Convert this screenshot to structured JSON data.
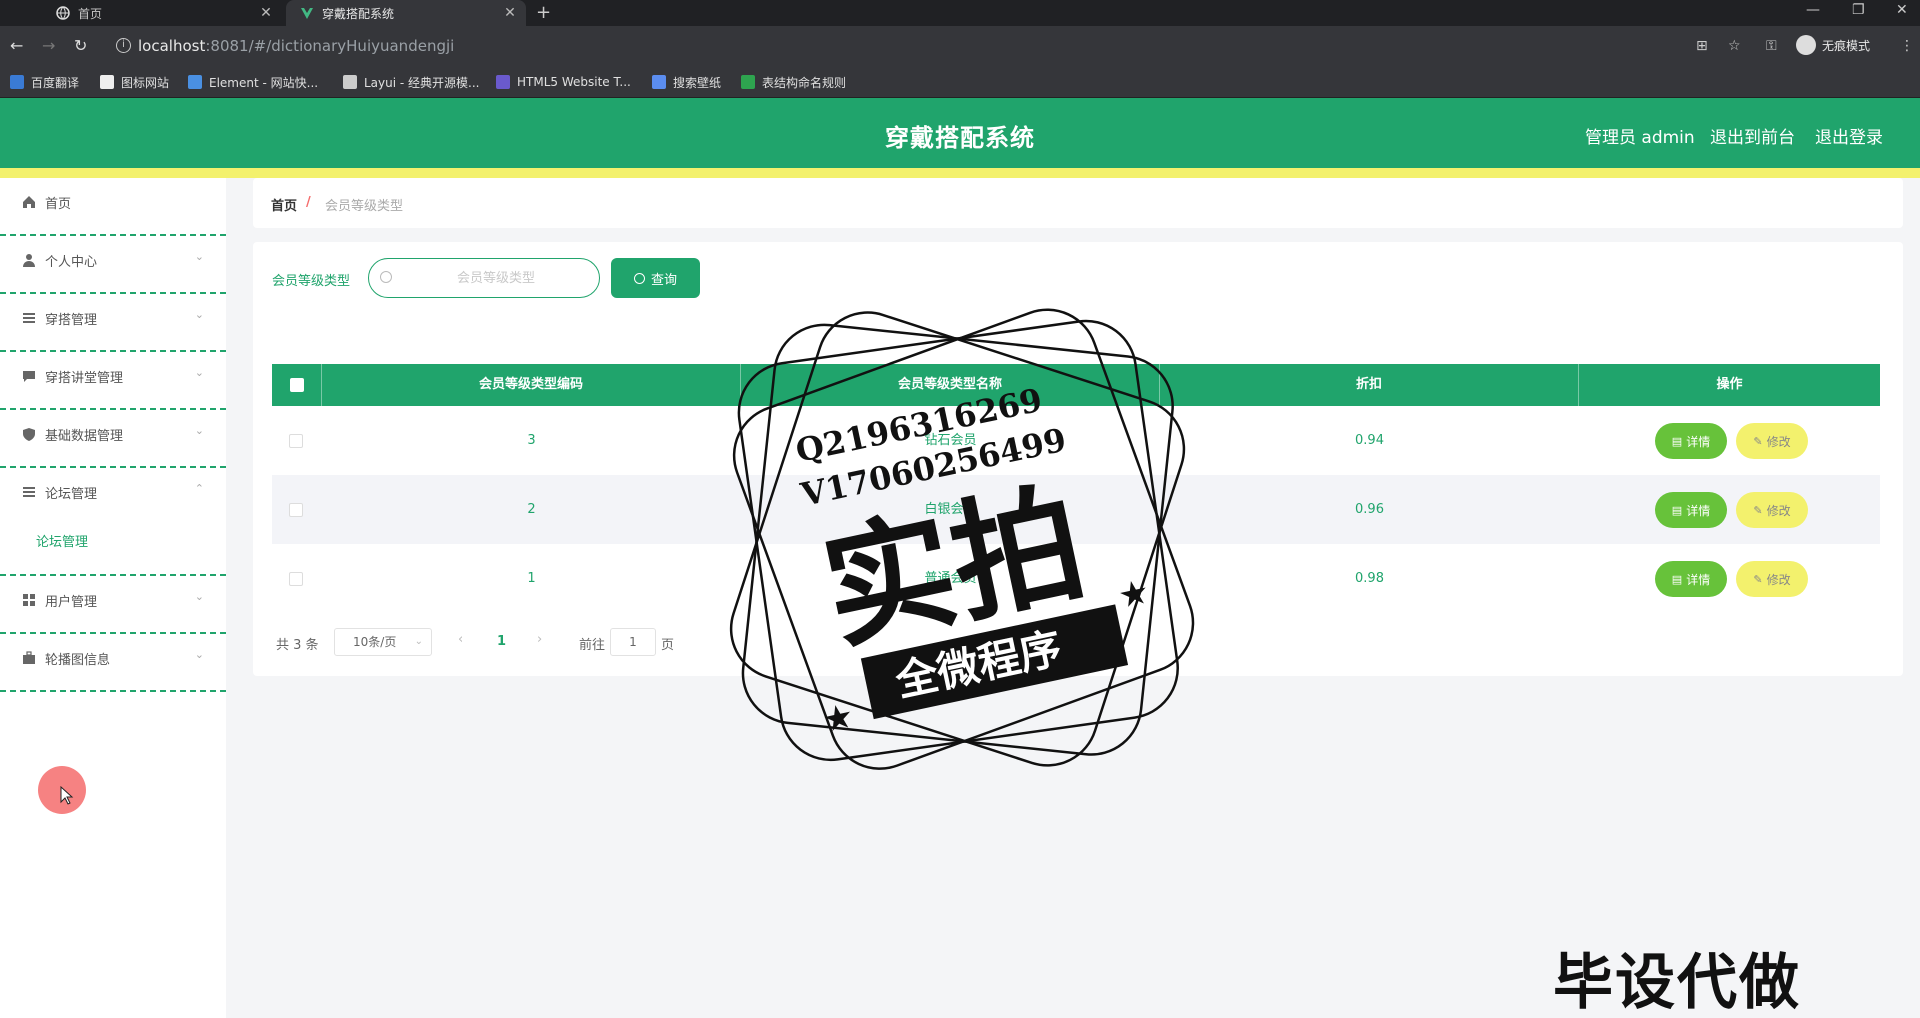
{
  "browser": {
    "tabs": [
      {
        "label": "首页",
        "active": false
      },
      {
        "label": "穿戴搭配系统",
        "active": true
      }
    ],
    "url_host": "localhost",
    "url_rest": ":8081/#/dictionaryHuiyuandengji",
    "incognito_label": "无痕模式",
    "bookmarks": [
      {
        "label": "百度翻译",
        "color": "#3a7bd5"
      },
      {
        "label": "图标网站",
        "color": "#eeeeee"
      },
      {
        "label": "Element - 网站快...",
        "color": "#4a90e2"
      },
      {
        "label": "Layui - 经典开源模...",
        "color": "#cccccc"
      },
      {
        "label": "HTML5 Website T...",
        "color": "#6a5acd"
      },
      {
        "label": "搜索壁纸",
        "color": "#5b8def"
      },
      {
        "label": "表结构命名规则",
        "color": "#2ea44f"
      }
    ]
  },
  "header": {
    "title": "穿戴搭配系统",
    "admin_label": "管理员 admin",
    "front_label": "退出到前台",
    "logout_label": "退出登录"
  },
  "sidebar": {
    "items": [
      {
        "label": "首页",
        "icon": "home-icon",
        "has_arrow": false
      },
      {
        "label": "个人中心",
        "icon": "user-icon",
        "has_arrow": true
      },
      {
        "label": "穿搭管理",
        "icon": "menu-icon",
        "has_arrow": true
      },
      {
        "label": "穿搭讲堂管理",
        "icon": "chat-icon",
        "has_arrow": true
      },
      {
        "label": "基础数据管理",
        "icon": "shield-icon",
        "has_arrow": true
      },
      {
        "label": "论坛管理",
        "icon": "menu-icon",
        "has_arrow": true,
        "expanded": true
      },
      {
        "label": "用户管理",
        "icon": "grid-icon",
        "has_arrow": true
      },
      {
        "label": "轮播图信息",
        "icon": "briefcase-icon",
        "has_arrow": true
      }
    ],
    "submenu": {
      "label": "论坛管理"
    }
  },
  "breadcrumb": {
    "home": "首页",
    "separator": "/",
    "current": "会员等级类型"
  },
  "search": {
    "label": "会员等级类型",
    "placeholder": "会员等级类型",
    "button": "查询"
  },
  "table": {
    "columns": [
      "会员等级类型编码",
      "会员等级类型名称",
      "折扣",
      "操作"
    ],
    "rows": [
      {
        "code": "3",
        "name": "钻石会员",
        "discount": "0.94"
      },
      {
        "code": "2",
        "name": "白银会员",
        "discount": "0.96"
      },
      {
        "code": "1",
        "name": "普通会员",
        "discount": "0.98"
      }
    ],
    "detail_label": "详情",
    "edit_label": "修改"
  },
  "pagination": {
    "total": "共 3 条",
    "page_size": "10条/页",
    "current": "1",
    "goto_label": "前往",
    "goto_value": "1",
    "page_suffix": "页"
  },
  "watermark": {
    "line1": "Q2196316269",
    "line2": "V17060256499",
    "big": "实拍",
    "banner": "全微程序",
    "corner": "毕设代做"
  },
  "colors": {
    "primary": "#20a46c",
    "accent_yellow": "#f3f16d",
    "detail_green": "#67c23a"
  }
}
